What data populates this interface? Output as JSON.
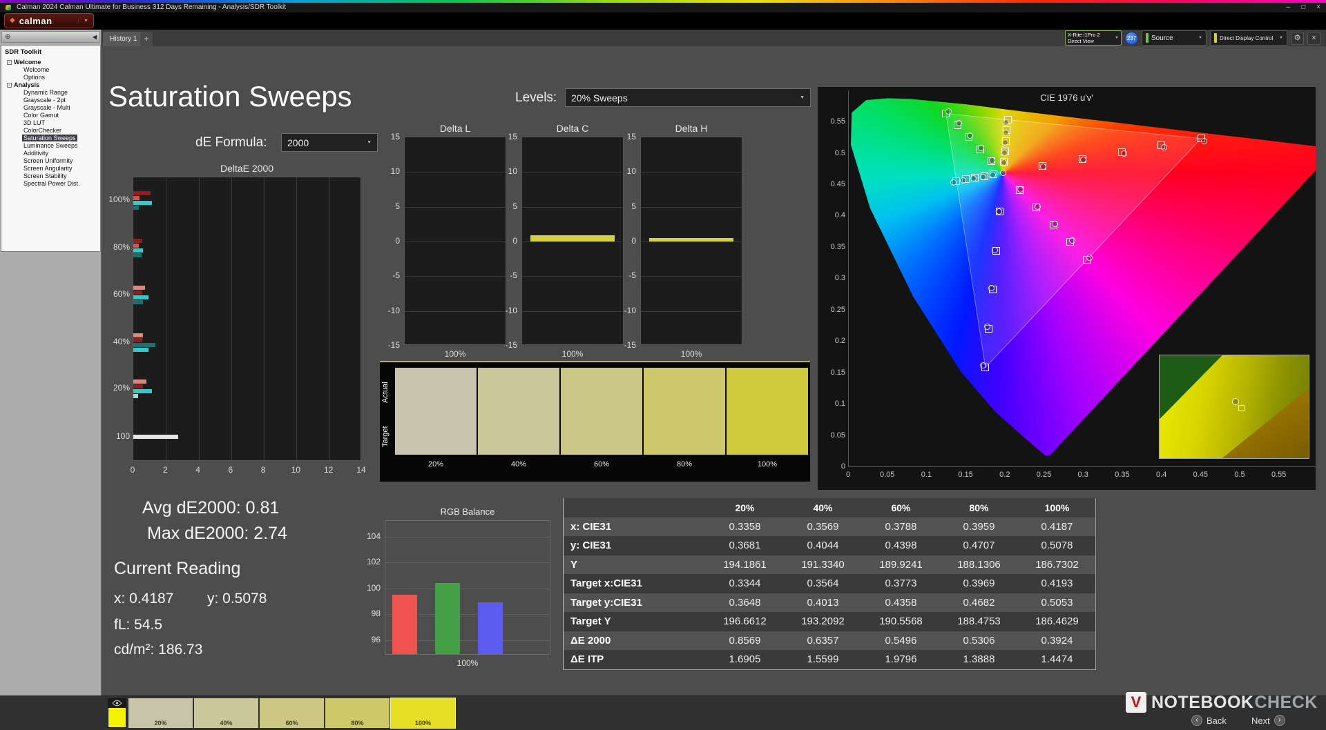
{
  "window": {
    "title": "Calman 2024 Calman Ultimate for Business 312 Days Remaining  - Analysis/SDR Toolkit",
    "brand": "calman"
  },
  "icons": {
    "minimize": "–",
    "maximize": "□",
    "close": "×",
    "dropdown": "▼",
    "collapse_left": "◀",
    "plus": "+",
    "expander": "-",
    "gear": "⚙",
    "brand_diamond": "◆",
    "crosshair": "⊕",
    "back_arrow": "‹",
    "next_arrow": "›"
  },
  "tab_bar": {
    "history_tab": "History 1"
  },
  "meter_bar": {
    "meter_name": "X-Rite i1Pro 2",
    "meter_mode": "Direct View",
    "badge_count": "237",
    "source_label": "Source",
    "display_control_label": "Direct Display Control",
    "source_accent": "#7ac142",
    "display_accent": "#d6d22a"
  },
  "sidebar": {
    "title": "SDR Toolkit",
    "selected": "Saturation Sweeps",
    "groups": [
      {
        "label": "Welcome",
        "items": [
          "Welcome",
          "Options"
        ]
      },
      {
        "label": "Analysis",
        "items": [
          "Dynamic Range",
          "Grayscale - 2pt",
          "Grayscale - Multi",
          "Color Gamut",
          "3D LUT",
          "ColorChecker",
          "Saturation Sweeps",
          "Luminance Sweeps",
          "Additivity",
          "Screen Uniformity",
          "Screen Angularity",
          "Screen Stability",
          "Spectral Power Dist."
        ]
      }
    ]
  },
  "page": {
    "title": "Saturation Sweeps",
    "levels_label": "Levels:",
    "levels_value": "20% Sweeps",
    "de_formula_label": "dE Formula:",
    "de_formula_value": "2000"
  },
  "readings": {
    "avg": "Avg dE2000: 0.81",
    "max": "Max dE2000: 2.74",
    "heading": "Current Reading",
    "x": "x: 0.4187",
    "y": "y: 0.5078",
    "fl": "fL: 54.5",
    "cd": "cd/m²: 186.73"
  },
  "swatch_panel": {
    "row_labels": [
      "Actual",
      "Target"
    ],
    "items": [
      {
        "label": "20%",
        "color": "#c7c4ad"
      },
      {
        "label": "40%",
        "color": "#c9c69c"
      },
      {
        "label": "60%",
        "color": "#cbc886"
      },
      {
        "label": "80%",
        "color": "#cdc96a"
      },
      {
        "label": "100%",
        "color": "#d0ca3d"
      }
    ]
  },
  "chart_data": {
    "deltae": {
      "type": "bar",
      "title": "DeltaE 2000",
      "x_ticks": [
        0,
        2,
        4,
        6,
        8,
        10,
        12,
        14
      ],
      "xlim": [
        0,
        14
      ],
      "groups": [
        {
          "label": "100%",
          "bars": [
            {
              "color": "#8d1f1f",
              "value": 1.05
            },
            {
              "color": "#d95050",
              "value": 0.4
            },
            {
              "color": "#38c8c8",
              "value": 1.15
            },
            {
              "color": "#1e6f6f",
              "value": 0.35
            }
          ]
        },
        {
          "label": "80%",
          "bars": [
            {
              "color": "#8d1f1f",
              "value": 0.55
            },
            {
              "color": "#d95050",
              "value": 0.35
            },
            {
              "color": "#38c8c8",
              "value": 0.6
            },
            {
              "color": "#1e6f6f",
              "value": 0.5
            }
          ]
        },
        {
          "label": "60%",
          "bars": [
            {
              "color": "#d98a80",
              "value": 0.7
            },
            {
              "color": "#8d1f1f",
              "value": 0.55
            },
            {
              "color": "#38c8c8",
              "value": 0.95
            },
            {
              "color": "#1e6f6f",
              "value": 0.6
            }
          ]
        },
        {
          "label": "40%",
          "bars": [
            {
              "color": "#d98a80",
              "value": 0.6
            },
            {
              "color": "#8d1f1f",
              "value": 0.55
            },
            {
              "color": "#1e6f6f",
              "value": 1.35
            },
            {
              "color": "#38c8c8",
              "value": 0.95
            }
          ]
        },
        {
          "label": "20%",
          "bars": [
            {
              "color": "#d98a80",
              "value": 0.8
            },
            {
              "color": "#8d1f1f",
              "value": 0.6
            },
            {
              "color": "#38c8c8",
              "value": 1.15
            },
            {
              "color": "#9fd8d8",
              "value": 0.3
            }
          ]
        },
        {
          "label": "100",
          "bars": [
            {
              "color": "#e6e6e6",
              "value": 2.74
            }
          ]
        }
      ]
    },
    "delta_l": {
      "type": "bar",
      "title": "Delta L",
      "x_label": "100%",
      "y_ticks": [
        15,
        10,
        5,
        0,
        -5,
        -10,
        -15
      ],
      "ylim": [
        -15,
        15
      ],
      "value": 0,
      "color": "#d6d23b"
    },
    "delta_c": {
      "type": "bar",
      "title": "Delta C",
      "x_label": "100%",
      "y_ticks": [
        15,
        10,
        5,
        0,
        -5,
        -10,
        -15
      ],
      "ylim": [
        -15,
        15
      ],
      "value": 0.9,
      "color": "#d6d23b"
    },
    "delta_h": {
      "type": "bar",
      "title": "Delta H",
      "x_label": "100%",
      "y_ticks": [
        15,
        10,
        5,
        0,
        -5,
        -10,
        -15
      ],
      "ylim": [
        -15,
        15
      ],
      "value": 0.45,
      "color": "#d6d23b"
    },
    "rgb_balance": {
      "type": "bar",
      "title": "RGB Balance",
      "x_label": "100%",
      "y_ticks": [
        104,
        102,
        100,
        98,
        96
      ],
      "ylim": [
        94.8,
        105.2
      ],
      "bars": [
        {
          "name": "red",
          "color": "#ef5350",
          "value": 99.4
        },
        {
          "name": "green",
          "color": "#43a047",
          "value": 100.3
        },
        {
          "name": "blue",
          "color": "#5c5cf0",
          "value": 98.8
        }
      ]
    },
    "cie": {
      "type": "scatter",
      "title": "CIE 1976 u'v'",
      "x_ticks": [
        "0",
        "0.05",
        "0.1",
        "0.15",
        "0.2",
        "0.25",
        "0.3",
        "0.35",
        "0.4",
        "0.45",
        "0.5",
        "0.55"
      ],
      "y_ticks": [
        "0.55",
        "0.5",
        "0.45",
        "0.4",
        "0.35",
        "0.3",
        "0.25",
        "0.2",
        "0.15",
        "0.1",
        "0.05",
        "0"
      ],
      "white_point": [
        0.1978,
        0.4683
      ],
      "saturation_fractions": [
        0.2,
        0.4,
        0.6,
        0.8,
        1.0
      ],
      "sweep_primaries": [
        {
          "name": "red",
          "uv": [
            0.4507,
            0.5229
          ]
        },
        {
          "name": "green",
          "uv": [
            0.125,
            0.5625
          ]
        },
        {
          "name": "blue",
          "uv": [
            0.1754,
            0.1579
          ]
        },
        {
          "name": "cyan",
          "uv": [
            0.1384,
            0.4554
          ]
        },
        {
          "name": "magenta",
          "uv": [
            0.305,
            0.3299
          ]
        },
        {
          "name": "yellow",
          "uv": [
            0.2039,
            0.5529
          ]
        }
      ]
    },
    "results_table": {
      "type": "table",
      "columns": [
        "20%",
        "40%",
        "60%",
        "80%",
        "100%"
      ],
      "rows": [
        {
          "label": "x: CIE31",
          "values": [
            "0.3358",
            "0.3569",
            "0.3788",
            "0.3959",
            "0.4187"
          ]
        },
        {
          "label": "y: CIE31",
          "values": [
            "0.3681",
            "0.4044",
            "0.4398",
            "0.4707",
            "0.5078"
          ]
        },
        {
          "label": "Y",
          "values": [
            "194.1861",
            "191.3340",
            "189.9241",
            "188.1306",
            "186.7302"
          ]
        },
        {
          "label": "Target x:CIE31",
          "values": [
            "0.3344",
            "0.3564",
            "0.3773",
            "0.3969",
            "0.4193"
          ]
        },
        {
          "label": "Target y:CIE31",
          "values": [
            "0.3648",
            "0.4013",
            "0.4358",
            "0.4682",
            "0.5053"
          ]
        },
        {
          "label": "Target Y",
          "values": [
            "196.6612",
            "193.2092",
            "190.5568",
            "188.4753",
            "186.4629"
          ]
        },
        {
          "label": "ΔE 2000",
          "values": [
            "0.8569",
            "0.6357",
            "0.5496",
            "0.5306",
            "0.3924"
          ]
        },
        {
          "label": "ΔE ITP",
          "values": [
            "1.6905",
            "1.5599",
            "1.9796",
            "1.3888",
            "1.4474"
          ]
        }
      ]
    }
  },
  "bottom_bar": {
    "eye_tile_color": "#f6f300",
    "tiles": [
      {
        "label": "20%",
        "color": "#c7c5a9"
      },
      {
        "label": "40%",
        "color": "#cac79a"
      },
      {
        "label": "60%",
        "color": "#ccc884"
      },
      {
        "label": "80%",
        "color": "#cec969"
      },
      {
        "label": "100%",
        "color": "#e6df25",
        "selected": true
      }
    ],
    "back": "Back",
    "next": "Next"
  },
  "watermark": {
    "part1": "NOTEBOOK",
    "part2": "CHECK"
  }
}
